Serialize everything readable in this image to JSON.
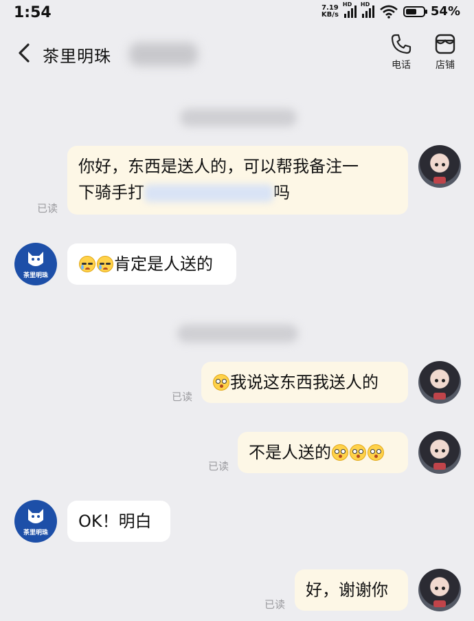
{
  "status_bar": {
    "time": "1:54",
    "net_speed_value": "7.19",
    "net_speed_unit": "KB/s",
    "signal1_label": "HD",
    "signal2_label": "HD",
    "battery": "54%",
    "battery_level": 0.54
  },
  "header": {
    "title": "茶里明珠",
    "call_label": "电话",
    "shop_label": "店铺",
    "icons": [
      "back-arrow-icon",
      "phone-icon",
      "store-icon"
    ]
  },
  "messages": [
    {
      "side": "out",
      "text_before": "你好，东西是送人的，可以帮我备注一",
      "text_line2": "下骑手打",
      "text_after": "吗",
      "status": "已读"
    },
    {
      "side": "in",
      "emojis": "sad-tear-emoji x2",
      "text": "肯定是人送的"
    },
    {
      "side": "out",
      "text": "我说这东西我送人的",
      "status": "已读"
    },
    {
      "side": "out",
      "text": "不是人送的",
      "status": "已读"
    },
    {
      "side": "in",
      "text": "OK！明白"
    },
    {
      "side": "out",
      "text": "好，谢谢你",
      "status": "已读"
    }
  ],
  "shop_avatar": {
    "brand_text": "茶里明珠"
  },
  "colors": {
    "background": "#ededf0",
    "outgoing_bubble": "#fdf7e6",
    "incoming_bubble": "#ffffff",
    "shop_avatar": "#1d4fa8"
  }
}
